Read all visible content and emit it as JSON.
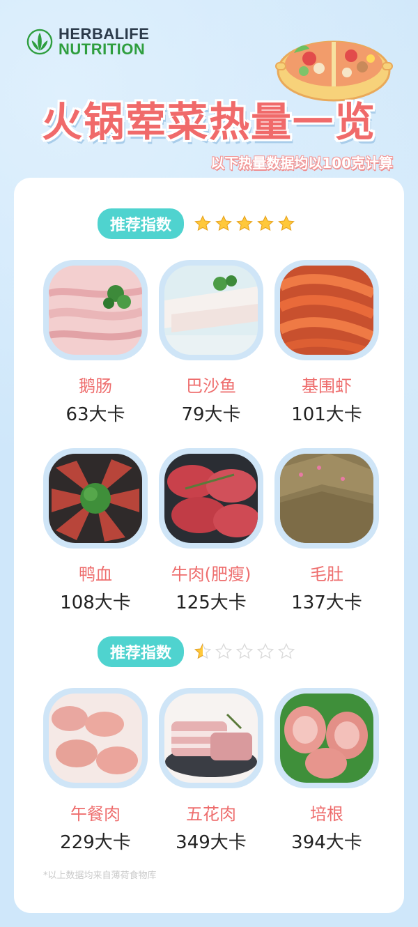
{
  "brand": {
    "line1": "HERBALIFE",
    "line2": "NUTRITION"
  },
  "title": "火锅荤菜热量一览",
  "subtitle": "以下热量数据均以100克计算",
  "sections": [
    {
      "label": "推荐指数",
      "rating": 5,
      "items": [
        {
          "name": "鹅肠",
          "calories": "63大卡",
          "icon": "goose-intestine"
        },
        {
          "name": "巴沙鱼",
          "calories": "79大卡",
          "icon": "basa-fish"
        },
        {
          "name": "基围虾",
          "calories": "101大卡",
          "icon": "shrimp"
        },
        {
          "name": "鸭血",
          "calories": "108大卡",
          "icon": "duck-blood"
        },
        {
          "name": "牛肉(肥瘦)",
          "calories": "125大卡",
          "icon": "beef"
        },
        {
          "name": "毛肚",
          "calories": "137大卡",
          "icon": "tripe"
        }
      ]
    },
    {
      "label": "推荐指数",
      "rating": 0.5,
      "items": [
        {
          "name": "午餐肉",
          "calories": "229大卡",
          "icon": "luncheon-meat"
        },
        {
          "name": "五花肉",
          "calories": "349大卡",
          "icon": "pork-belly"
        },
        {
          "name": "培根",
          "calories": "394大卡",
          "icon": "bacon"
        }
      ]
    }
  ],
  "footnote": "*以上数据均来自薄荷食物库",
  "colors": {
    "accent_pill": "#4fd3cf",
    "food_name": "#ee6d6d",
    "title": "#f06a6a",
    "background": "#cfe7fa"
  }
}
